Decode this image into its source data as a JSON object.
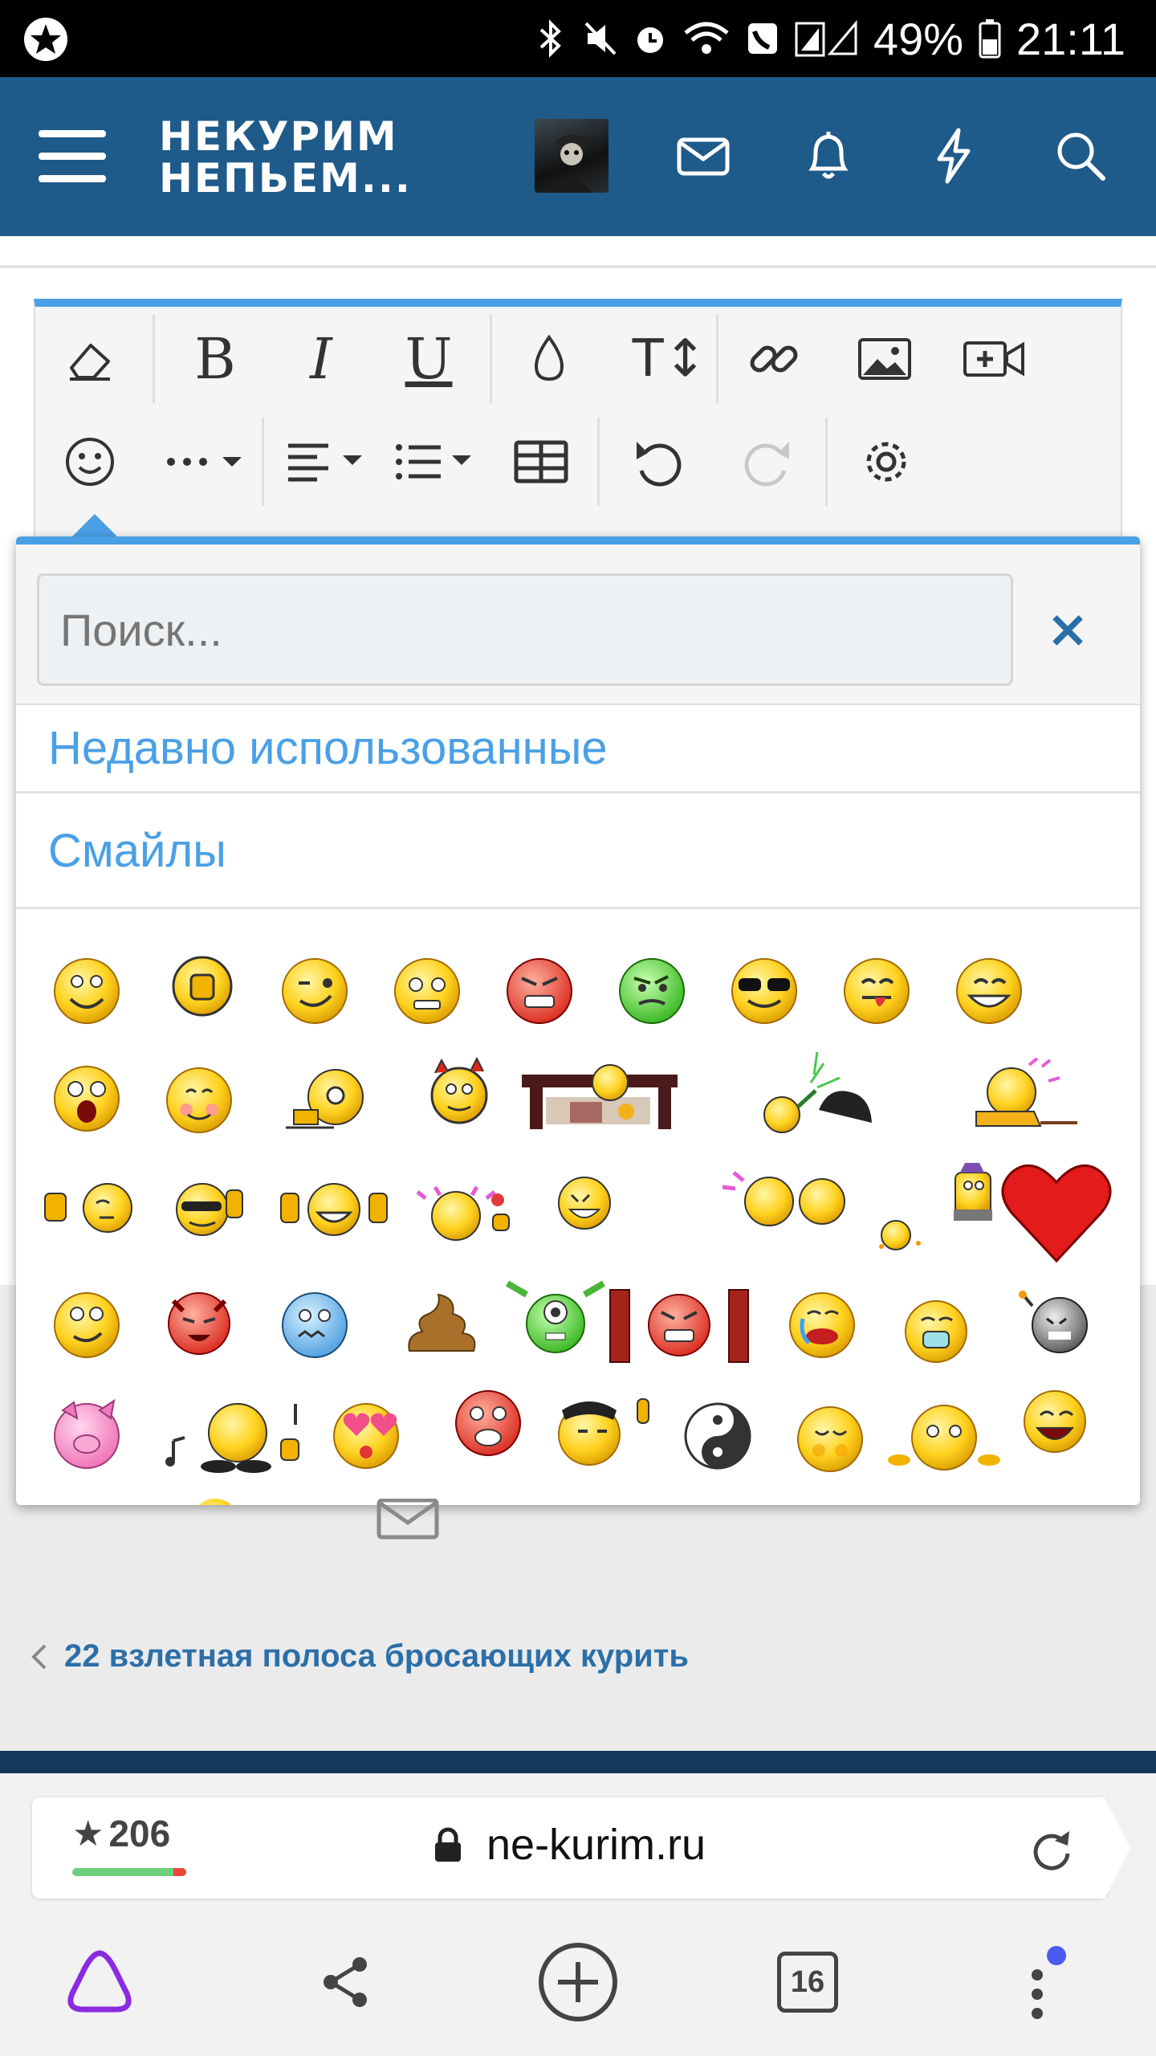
{
  "status_bar": {
    "battery": "49%",
    "time": "21:11",
    "icons": [
      "notification-star-icon",
      "bluetooth-icon",
      "mute-icon",
      "alarm-icon",
      "wifi-icon",
      "wifi-call-icon",
      "signal-icon",
      "battery-icon"
    ]
  },
  "header": {
    "logo_line1": "НЕКУРИМ",
    "logo_line2": "НЕПЬЕМ...",
    "icons": [
      "menu-icon",
      "avatar",
      "mail-icon",
      "bell-icon",
      "lightning-icon",
      "search-icon"
    ],
    "color": "#1e5a8a"
  },
  "toolbar": {
    "row1": [
      "eraser-icon",
      "bold-icon",
      "italic-icon",
      "underline-icon",
      "color-drop-icon",
      "font-size-icon",
      "link-icon",
      "image-icon",
      "video-icon"
    ],
    "row2": [
      "smiley-icon",
      "more-icon",
      "align-icon",
      "list-icon",
      "table-icon",
      "undo-icon",
      "redo-icon",
      "settings-icon"
    ],
    "bold": "B",
    "italic": "I",
    "underline": "U",
    "font_size": "T↕"
  },
  "emoji_picker": {
    "search_placeholder": "Поиск...",
    "close": "×",
    "categories": [
      "Недавно использованные",
      "Смайлы"
    ],
    "accent": "#4aa0e6"
  },
  "page": {
    "thread_link": "22 взлетная полоса бросающих курить"
  },
  "browser": {
    "rating": "206",
    "domain": "ne-kurim.ru",
    "tabs_count": "16"
  }
}
